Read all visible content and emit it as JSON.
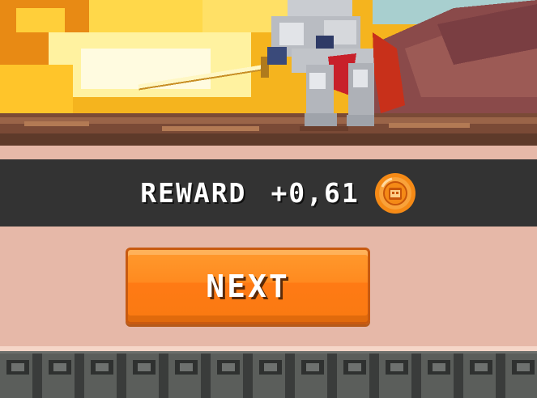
{
  "reward": {
    "label": "REWARD",
    "value": "+0,61",
    "coin_icon": "coin-icon"
  },
  "next_button": {
    "label": "NEXT"
  },
  "colors": {
    "reward_bar": "#333333",
    "button": "#ff8a1f",
    "background": "#e6b8a8",
    "coin": "#f58a16"
  }
}
